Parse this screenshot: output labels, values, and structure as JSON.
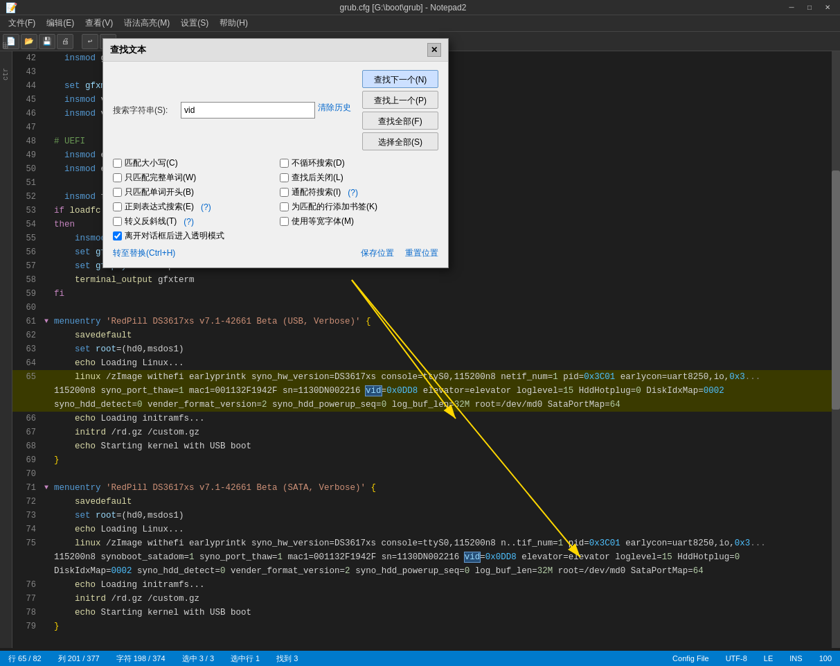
{
  "titleBar": {
    "icon": "📝",
    "title": "grub.cfg [G:\\boot\\grub] - Notepad2",
    "minimize": "─",
    "maximize": "□",
    "close": "✕"
  },
  "menuBar": {
    "items": [
      "文件(F)",
      "编辑(E)",
      "查看(V)",
      "语法高亮(M)",
      "设置(S)",
      "帮助(H)"
    ]
  },
  "findDialog": {
    "title": "查找文本",
    "searchLabel": "搜索字符串(S):",
    "clearHistory": "清除历史",
    "searchValue": "vid",
    "findNext": "查找下一个(N)",
    "findPrev": "查找上一个(P)",
    "findAll": "查找全部(F)",
    "selectAll": "选择全部(S)",
    "options": [
      {
        "id": "match-case",
        "label": "匹配大小写(C)",
        "checked": false
      },
      {
        "id": "whole-word",
        "label": "只匹配完整单词(W)",
        "checked": false
      },
      {
        "id": "word-start",
        "label": "只匹配单词开头(B)",
        "checked": false
      },
      {
        "id": "regex",
        "label": "正则表达式搜索(E)",
        "checked": false
      },
      {
        "id": "escape",
        "label": "转义反斜线(T)",
        "checked": false
      },
      {
        "id": "transparent",
        "label": "离开对话框后进入透明模式",
        "checked": true
      }
    ],
    "options2": [
      {
        "id": "no-wrap",
        "label": "不循环搜索(D)",
        "checked": false
      },
      {
        "id": "close-on-find",
        "label": "查找后关闭(L)",
        "checked": false
      },
      {
        "id": "wildcard",
        "label": "通配符搜索(I)",
        "checked": false
      },
      {
        "id": "bookmark",
        "label": "为匹配的行添加书签(K)",
        "checked": false
      },
      {
        "id": "fullwidth",
        "label": "使用等宽字体(M)",
        "checked": false
      }
    ],
    "helpLink1": "(?)",
    "helpLink2": "(?)",
    "savePosition": "保存位置",
    "resetPosition": "重置位置",
    "gotoReplace": "转至替换(Ctrl+H)"
  },
  "editor": {
    "lines": [
      {
        "num": "42",
        "content": "  insmod gz",
        "indent": 1
      },
      {
        "num": "43",
        "content": ""
      },
      {
        "num": "44",
        "content": "  set gfxmode=auto",
        "indent": 1
      },
      {
        "num": "45",
        "content": "  insmod vb",
        "indent": 1
      },
      {
        "num": "46",
        "content": "  insmod vg",
        "indent": 1
      },
      {
        "num": "47",
        "content": ""
      },
      {
        "num": "48",
        "content": "# UEFI",
        "indent": 0
      },
      {
        "num": "49",
        "content": "  insmod ef",
        "indent": 1
      },
      {
        "num": "50",
        "content": "  insmod ef",
        "indent": 1
      },
      {
        "num": "51",
        "content": ""
      },
      {
        "num": "52",
        "content": "  insmod fo",
        "indent": 1
      },
      {
        "num": "53",
        "content": "if loadfc",
        "indent": 0
      },
      {
        "num": "54",
        "content": "then",
        "indent": 0
      },
      {
        "num": "55",
        "content": "    insmod gfxterm",
        "indent": 2
      },
      {
        "num": "56",
        "content": "    set gfxmode=auto",
        "indent": 2
      },
      {
        "num": "57",
        "content": "    set gfxpayload=keep",
        "indent": 2
      },
      {
        "num": "58",
        "content": "    terminal_output gfxterm",
        "indent": 2
      },
      {
        "num": "59",
        "content": "fi",
        "indent": 0
      },
      {
        "num": "60",
        "content": ""
      },
      {
        "num": "61",
        "content": "menuentry 'RedPill DS3617xs v7.1-42661 Beta (USB, Verbose)' {",
        "indent": 0,
        "fold": true
      },
      {
        "num": "62",
        "content": "    savedefault",
        "indent": 2
      },
      {
        "num": "63",
        "content": "    set root=(hd0,msdos1)",
        "indent": 2
      },
      {
        "num": "64",
        "content": "    echo Loading Linux...",
        "indent": 2
      },
      {
        "num": "65",
        "content": "    linux /zImage withefi earlyprintk syno_hw_version=DS3617xs console=ttyS0,115200n8 netif_num=1 pid=0x3C01 earlycon=uart8250,io,0x3...",
        "indent": 2,
        "long": true
      },
      {
        "num": "65b",
        "content": "115200n8 syno_port_thaw=1 mac1=001132F1942F sn=1130DN002216 vid=0x0DD8 elevator=elevator loglevel=15 HddHotplug=0 DiskIdxMap=0002",
        "indent": 0,
        "continuation": true
      },
      {
        "num": "65c",
        "content": "syno_hdd_detect=0 vender_format_version=2 syno_hdd_powerup_seq=0 log_buf_len=32M root=/dev/md0 SataPortMap=64",
        "indent": 0,
        "continuation": true
      },
      {
        "num": "66",
        "content": "    echo Loading initramfs...",
        "indent": 2
      },
      {
        "num": "67",
        "content": "    initrd /rd.gz /custom.gz",
        "indent": 2
      },
      {
        "num": "68",
        "content": "    echo Starting kernel with USB boot",
        "indent": 2
      },
      {
        "num": "69",
        "content": "}",
        "indent": 0
      },
      {
        "num": "70",
        "content": ""
      },
      {
        "num": "71",
        "content": "menuentry 'RedPill DS3617xs v7.1-42661 Beta (SATA, Verbose)' {",
        "indent": 0,
        "fold": true
      },
      {
        "num": "72",
        "content": "    savedefault",
        "indent": 2
      },
      {
        "num": "73",
        "content": "    set root=(hd0,msdos1)",
        "indent": 2
      },
      {
        "num": "74",
        "content": "    echo Loading Linux...",
        "indent": 2
      },
      {
        "num": "75",
        "content": "    linux /zImage withefi earlyprintk syno_hw_version=DS3617xs console=ttyS0,115200n8 n..tif_num=1 pid=0x3C01 earlycon=uart8250,io,0x3...",
        "indent": 2,
        "long": true
      },
      {
        "num": "75b",
        "content": "115200n8 synoboot_satadom=1 syno_port_thaw=1 mac1=001132F1942F sn=1130DN002216 vid=0x0DD8 elevator=elevator loglevel=15 HddHotplug=0",
        "indent": 0,
        "continuation": true
      },
      {
        "num": "75c",
        "content": "DiskIdxMap=0002 syno_hdd_detect=0 vender_format_version=2 syno_hdd_powerup_seq=0 log_buf_len=32M root=/dev/md0 SataPortMap=64",
        "indent": 0,
        "continuation": true
      },
      {
        "num": "76",
        "content": "    echo Loading initramfs...",
        "indent": 2
      },
      {
        "num": "77",
        "content": "    initrd /rd.gz /custom.gz",
        "indent": 2
      },
      {
        "num": "78",
        "content": "    echo Starting kernel with USB boot",
        "indent": 2
      },
      {
        "num": "79",
        "content": "}",
        "indent": 0
      }
    ]
  },
  "statusBar": {
    "lineCol": "行 65 / 82",
    "col": "列 201 / 377",
    "chars": "字符 198 / 374",
    "selection": "选中 3 / 3",
    "encoding": "选中行 1",
    "found": "找到 3",
    "configFile": "Config File",
    "utf8": "UTF-8",
    "le": "LE",
    "ins": "INS",
    "zoom": "100"
  }
}
